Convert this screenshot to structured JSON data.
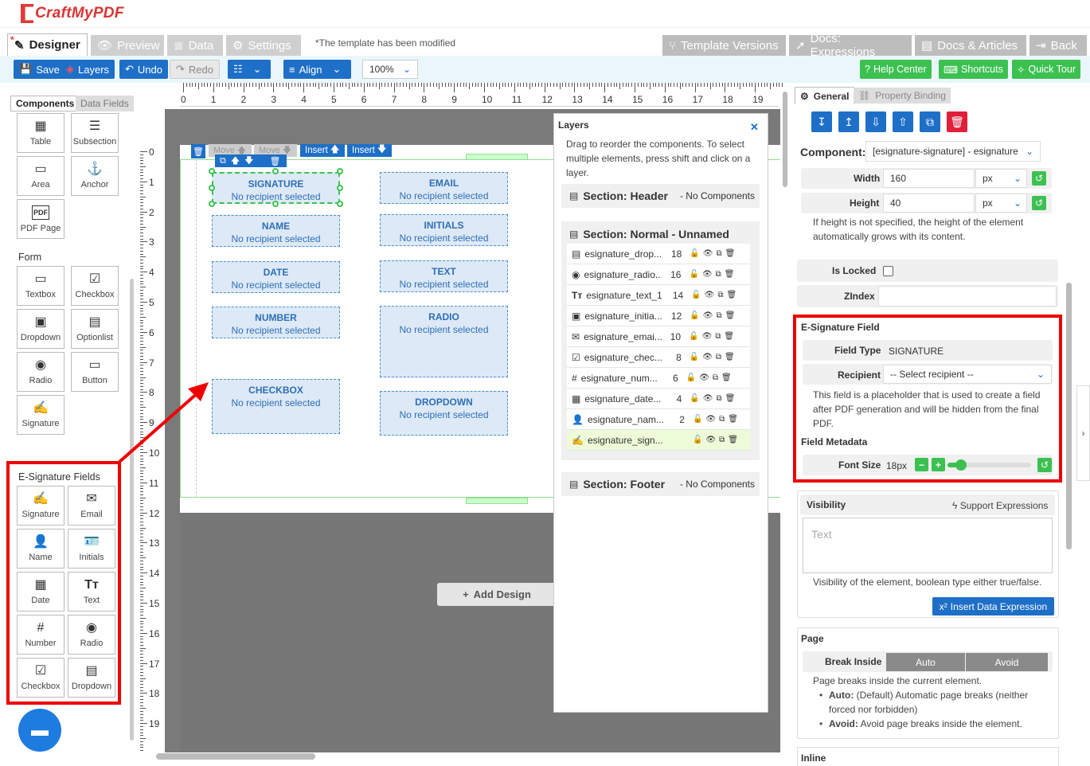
{
  "app": {
    "name": "CraftMyPDF"
  },
  "tabs": [
    {
      "label": "Designer",
      "active": true
    },
    {
      "label": "Preview"
    },
    {
      "label": "Data"
    },
    {
      "label": "Settings"
    }
  ],
  "modified_text": "*The template has been modified",
  "right_tabs": [
    {
      "label": "Template Versions"
    },
    {
      "label": "Docs: Expressions"
    },
    {
      "label": "Docs & Articles"
    },
    {
      "label": "Back"
    }
  ],
  "toolbar": {
    "save": "Save",
    "layers": "Layers",
    "undo": "Undo",
    "redo": "Redo",
    "align": "Align",
    "zoom": "100%",
    "help": "Help Center",
    "shortcuts": "Shortcuts",
    "tour": "Quick Tour"
  },
  "left": {
    "tab_components": "Components",
    "tab_data": "Data Fields",
    "components": [
      "Table",
      "Subsection",
      "Area",
      "Anchor",
      "PDF Page"
    ],
    "form_title": "Form",
    "form": [
      "Textbox",
      "Checkbox",
      "Dropdown",
      "Optionlist",
      "Radio",
      "Button",
      "Signature"
    ],
    "esig_title": "E-Signature Fields",
    "esig": [
      "Signature",
      "Email",
      "Name",
      "Initials",
      "Date",
      "Text",
      "Number",
      "Radio",
      "Checkbox",
      "Dropdown"
    ]
  },
  "ruler_h": [
    "0",
    "1",
    "2",
    "3",
    "4",
    "5",
    "6",
    "7",
    "8",
    "9",
    "10",
    "11",
    "12",
    "13",
    "14",
    "15",
    "16",
    "17",
    "18",
    "19"
  ],
  "ruler_v": [
    "0",
    "1",
    "2",
    "3",
    "4",
    "5",
    "6",
    "7",
    "8",
    "9",
    "10",
    "11",
    "12",
    "13",
    "14",
    "15",
    "16",
    "17",
    "18",
    "19"
  ],
  "canvas": {
    "move_up": "Move",
    "move_down": "Move",
    "insert_up": "Insert",
    "insert_down": "Insert",
    "add_design": "Add Design",
    "fields": [
      {
        "t": "SIGNATURE",
        "s": "No recipient selected"
      },
      {
        "t": "EMAIL",
        "s": "No recipient selected"
      },
      {
        "t": "NAME",
        "s": "No recipient selected"
      },
      {
        "t": "INITIALS",
        "s": "No recipient selected"
      },
      {
        "t": "DATE",
        "s": "No recipient selected"
      },
      {
        "t": "TEXT",
        "s": "No recipient selected"
      },
      {
        "t": "NUMBER",
        "s": "No recipient selected"
      },
      {
        "t": "RADIO",
        "s": "No recipient selected"
      },
      {
        "t": "CHECKBOX",
        "s": "No recipient selected"
      },
      {
        "t": "DROPDOWN",
        "s": "No recipient selected"
      }
    ]
  },
  "layers": {
    "title": "Layers",
    "desc": "Drag to reorder the components. To select multiple elements, press shift and click on a layer.",
    "header": "Section: Header",
    "header_note": "- No Components",
    "normal": "Section: Normal - Unnamed",
    "rows": [
      {
        "n": "esignature_drop...",
        "z": "18"
      },
      {
        "n": "esignature_radio...",
        "z": "16"
      },
      {
        "n": "esignature_text_1",
        "z": "14"
      },
      {
        "n": "esignature_initia...",
        "z": "12"
      },
      {
        "n": "esignature_emai...",
        "z": "10"
      },
      {
        "n": "esignature_chec...",
        "z": "8"
      },
      {
        "n": "esignature_num...",
        "z": "6"
      },
      {
        "n": "esignature_date...",
        "z": "4"
      },
      {
        "n": "esignature_nam...",
        "z": "2"
      },
      {
        "n": "esignature_sign...",
        "z": ""
      }
    ],
    "footer": "Section: Footer",
    "footer_note": "- No Components"
  },
  "right": {
    "tab_general": "General",
    "tab_binding": "Property Binding",
    "component_label": "Component:",
    "component_value": "[esignature-signature] - esignature",
    "width_label": "Width",
    "width_value": "160",
    "unit": "px",
    "height_label": "Height",
    "height_value": "40",
    "height_note": "If height is not specified, the height of the element automatically grows with its content.",
    "locked_label": "Is Locked",
    "zindex_label": "ZIndex",
    "esig_title": "E-Signature Field",
    "fieldtype_label": "Field Type",
    "fieldtype_value": "SIGNATURE",
    "recipient_label": "Recipient",
    "recipient_value": "-- Select recipient --",
    "esig_note": "This field is a placeholder that is used to create a field after PDF generation and will be hidden from the final PDF.",
    "metadata_title": "Field Metadata",
    "fontsize_label": "Font Size",
    "fontsize_value": "18px",
    "visibility_label": "Visibility",
    "support_expr": "Support Expressions",
    "visibility_placeholder": "Text",
    "visibility_note": "Visibility of the element, boolean type either true/false.",
    "insert_expr": "Insert Data Expression",
    "page_title": "Page",
    "break_label": "Break Inside",
    "break_auto": "Auto",
    "break_avoid": "Avoid",
    "break_note": "Page breaks inside the current element.",
    "auto_bold": "Auto:",
    "auto_text": "(Default) Automatic page breaks (neither forced nor forbidden)",
    "avoid_bold": "Avoid:",
    "avoid_text": "Avoid page breaks inside the element.",
    "inline_title": "Inline"
  },
  "colors": {
    "primary": "#1e6fc7",
    "green": "#3cc151",
    "red": "#e00000"
  }
}
